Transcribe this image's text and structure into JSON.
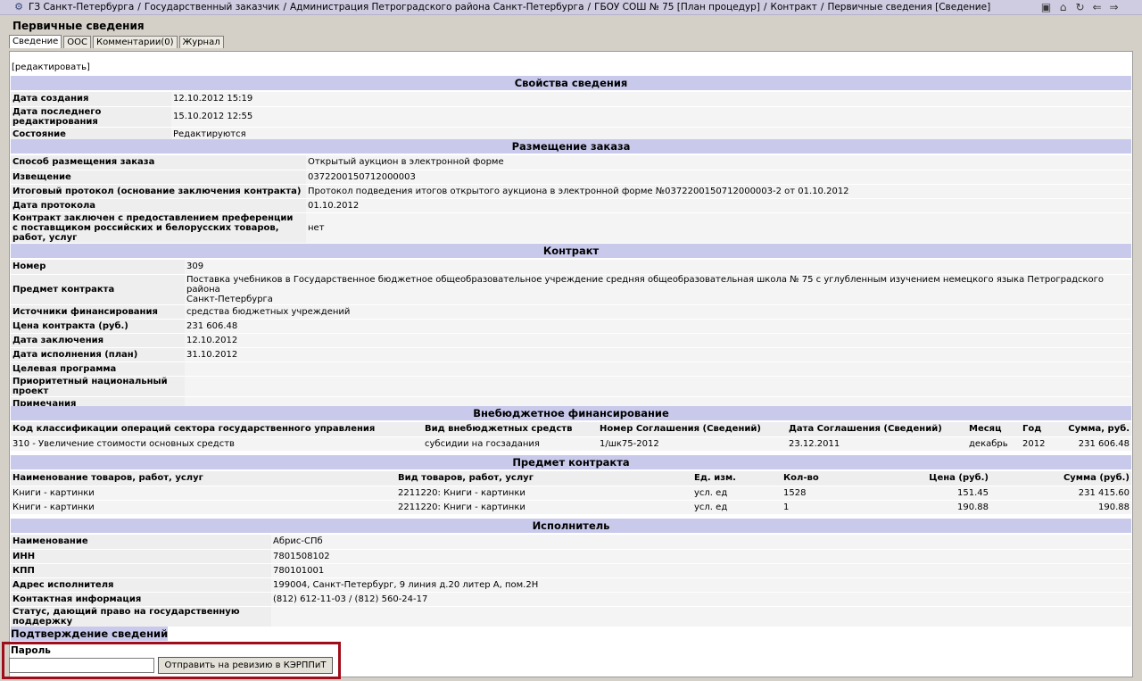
{
  "breadcrumbs": [
    "ГЗ Санкт-Петербурга",
    "Государственный заказчик",
    "Администрация Петроградского района Санкт-Петербурга",
    "ГБОУ СОШ № 75 [План процедур]",
    "Контракт",
    "Первичные сведения [Сведение]"
  ],
  "page_title": "Первичные сведения",
  "tabs": [
    "Сведение",
    "ООС",
    "Комментарии(0)",
    "Журнал"
  ],
  "edit_link": "[редактировать]",
  "props": {
    "title": "Свойства сведения",
    "rows": [
      {
        "label": "Дата создания",
        "value": "12.10.2012 15:19"
      },
      {
        "label": "Дата последнего редактирования",
        "value": "15.10.2012 12:55"
      },
      {
        "label": "Состояние",
        "value": "Редактируются"
      }
    ]
  },
  "placement": {
    "title": "Размещение заказа",
    "rows": [
      {
        "label": "Способ размещения заказа",
        "value": "Открытый аукцион в электронной форме"
      },
      {
        "label": "Извещение",
        "value": "0372200150712000003"
      },
      {
        "label": "Итоговый протокол (основание заключения контракта)",
        "value": "Протокол подведения итогов открытого аукциона в электронной форме №0372200150712000003-2 от 01.10.2012"
      },
      {
        "label": "Дата протокола",
        "value": "01.10.2012"
      },
      {
        "label": "Контракт заключен с предоставлением преференции",
        "label2": "с поставщиком российских и белорусских товаров, работ, услуг",
        "value": "нет"
      }
    ]
  },
  "contract": {
    "title": "Контракт",
    "rows": [
      {
        "label": "Номер",
        "value": "309"
      },
      {
        "label": "Предмет контракта",
        "value": "Поставка учебников в Государственное бюджетное общеобразовательное учреждение средняя общеобразовательная школа № 75 с углубленным изучением немецкого языка Петроградского района",
        "value2": "Санкт-Петербурга"
      },
      {
        "label": "Источники финансирования",
        "value": "средства бюджетных учреждений"
      },
      {
        "label": "Цена контракта (руб.)",
        "value": "231 606.48"
      },
      {
        "label": "Дата заключения",
        "value": "12.10.2012"
      },
      {
        "label": "Дата исполнения (план)",
        "value": "31.10.2012"
      },
      {
        "label": "Целевая программа",
        "value": ""
      },
      {
        "label": "Приоритетный национальный проект",
        "value": ""
      },
      {
        "label": "Примечания",
        "value": ""
      }
    ]
  },
  "extrabudget": {
    "title": "Внебюджетное финансирование",
    "headers": [
      "Код классификации операций сектора государственного управления",
      "Вид внебюджетных средств",
      "Номер Соглашения (Сведений)",
      "Дата Соглашения (Сведений)",
      "Месяц",
      "Год",
      "Сумма, руб."
    ],
    "rows": [
      [
        "310 - Увеличение стоимости основных средств",
        "субсидии на госзадания",
        "1/шк75-2012",
        "23.12.2011",
        "декабрь",
        "2012",
        "231 606.48"
      ]
    ]
  },
  "subject": {
    "title": "Предмет контракта",
    "headers": [
      "Наименование товаров, работ, услуг",
      "Вид товаров, работ, услуг",
      "Ед. изм.",
      "Кол-во",
      "Цена (руб.)",
      "Сумма (руб.)"
    ],
    "rows": [
      [
        "Книги - картинки",
        "2211220: Книги - картинки",
        "усл. ед",
        "1528",
        "151.45",
        "231 415.60"
      ],
      [
        "Книги - картинки",
        "2211220: Книги - картинки",
        "усл. ед",
        "1",
        "190.88",
        "190.88"
      ]
    ]
  },
  "executor": {
    "title": "Исполнитель",
    "rows": [
      {
        "label": "Наименование",
        "value": "Абрис-СПб"
      },
      {
        "label": "ИНН",
        "value": "7801508102"
      },
      {
        "label": "КПП",
        "value": "780101001"
      },
      {
        "label": "Адрес исполнителя",
        "value": "199004, Санкт-Петербург, 9 линия д.20 литер А, пом.2Н"
      },
      {
        "label": "Контактная информация",
        "value": "(812) 612-11-03 / (812) 560-24-17"
      },
      {
        "label": "Статус, дающий право на государственную поддержку",
        "value": ""
      }
    ]
  },
  "confirm": {
    "title": "Подтверждение сведений",
    "password_label": "Пароль",
    "password_value": "",
    "send_button": "Отправить на ревизию в КЭРППиТ"
  },
  "toolbar_icons": [
    "folder-icon",
    "home-icon",
    "refresh-icon",
    "back-arrow-icon",
    "forward-arrow-icon"
  ]
}
